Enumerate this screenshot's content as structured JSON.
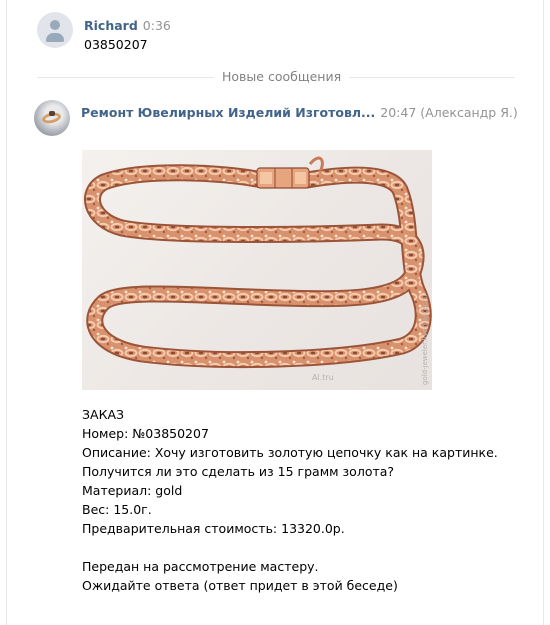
{
  "messages": [
    {
      "author": "Richard",
      "time": "0:36",
      "text": "03850207"
    }
  ],
  "divider": {
    "label": "Новые сообщения"
  },
  "reply": {
    "author": "Ремонт Ювелирных Изделий Изготовл...",
    "time": "20:47",
    "sender": "(Александр Я.)",
    "image": {
      "alt": "gold chain",
      "watermark": "Al.tru",
      "watermark_side": "gold-jeweler.livemaster.ru"
    },
    "lines": [
      "ЗАКАЗ",
      "Номер: №03850207",
      "Описание: Хочу изготовить золотую цепочку как на картинке.",
      "Получится ли это сделать из 15 грамм золота?",
      "Материал: gold",
      "Вес: 15.0г.",
      "Предварительная стоимость: 13320.0р.",
      "",
      "Передан на рассмотрение мастеру.",
      "Ожидайте ответа (ответ придет в этой беседе)"
    ]
  },
  "colors": {
    "link": "#42648b",
    "muted": "#939393",
    "divider": "#e7e8ec",
    "gold": "#d48f6b"
  }
}
